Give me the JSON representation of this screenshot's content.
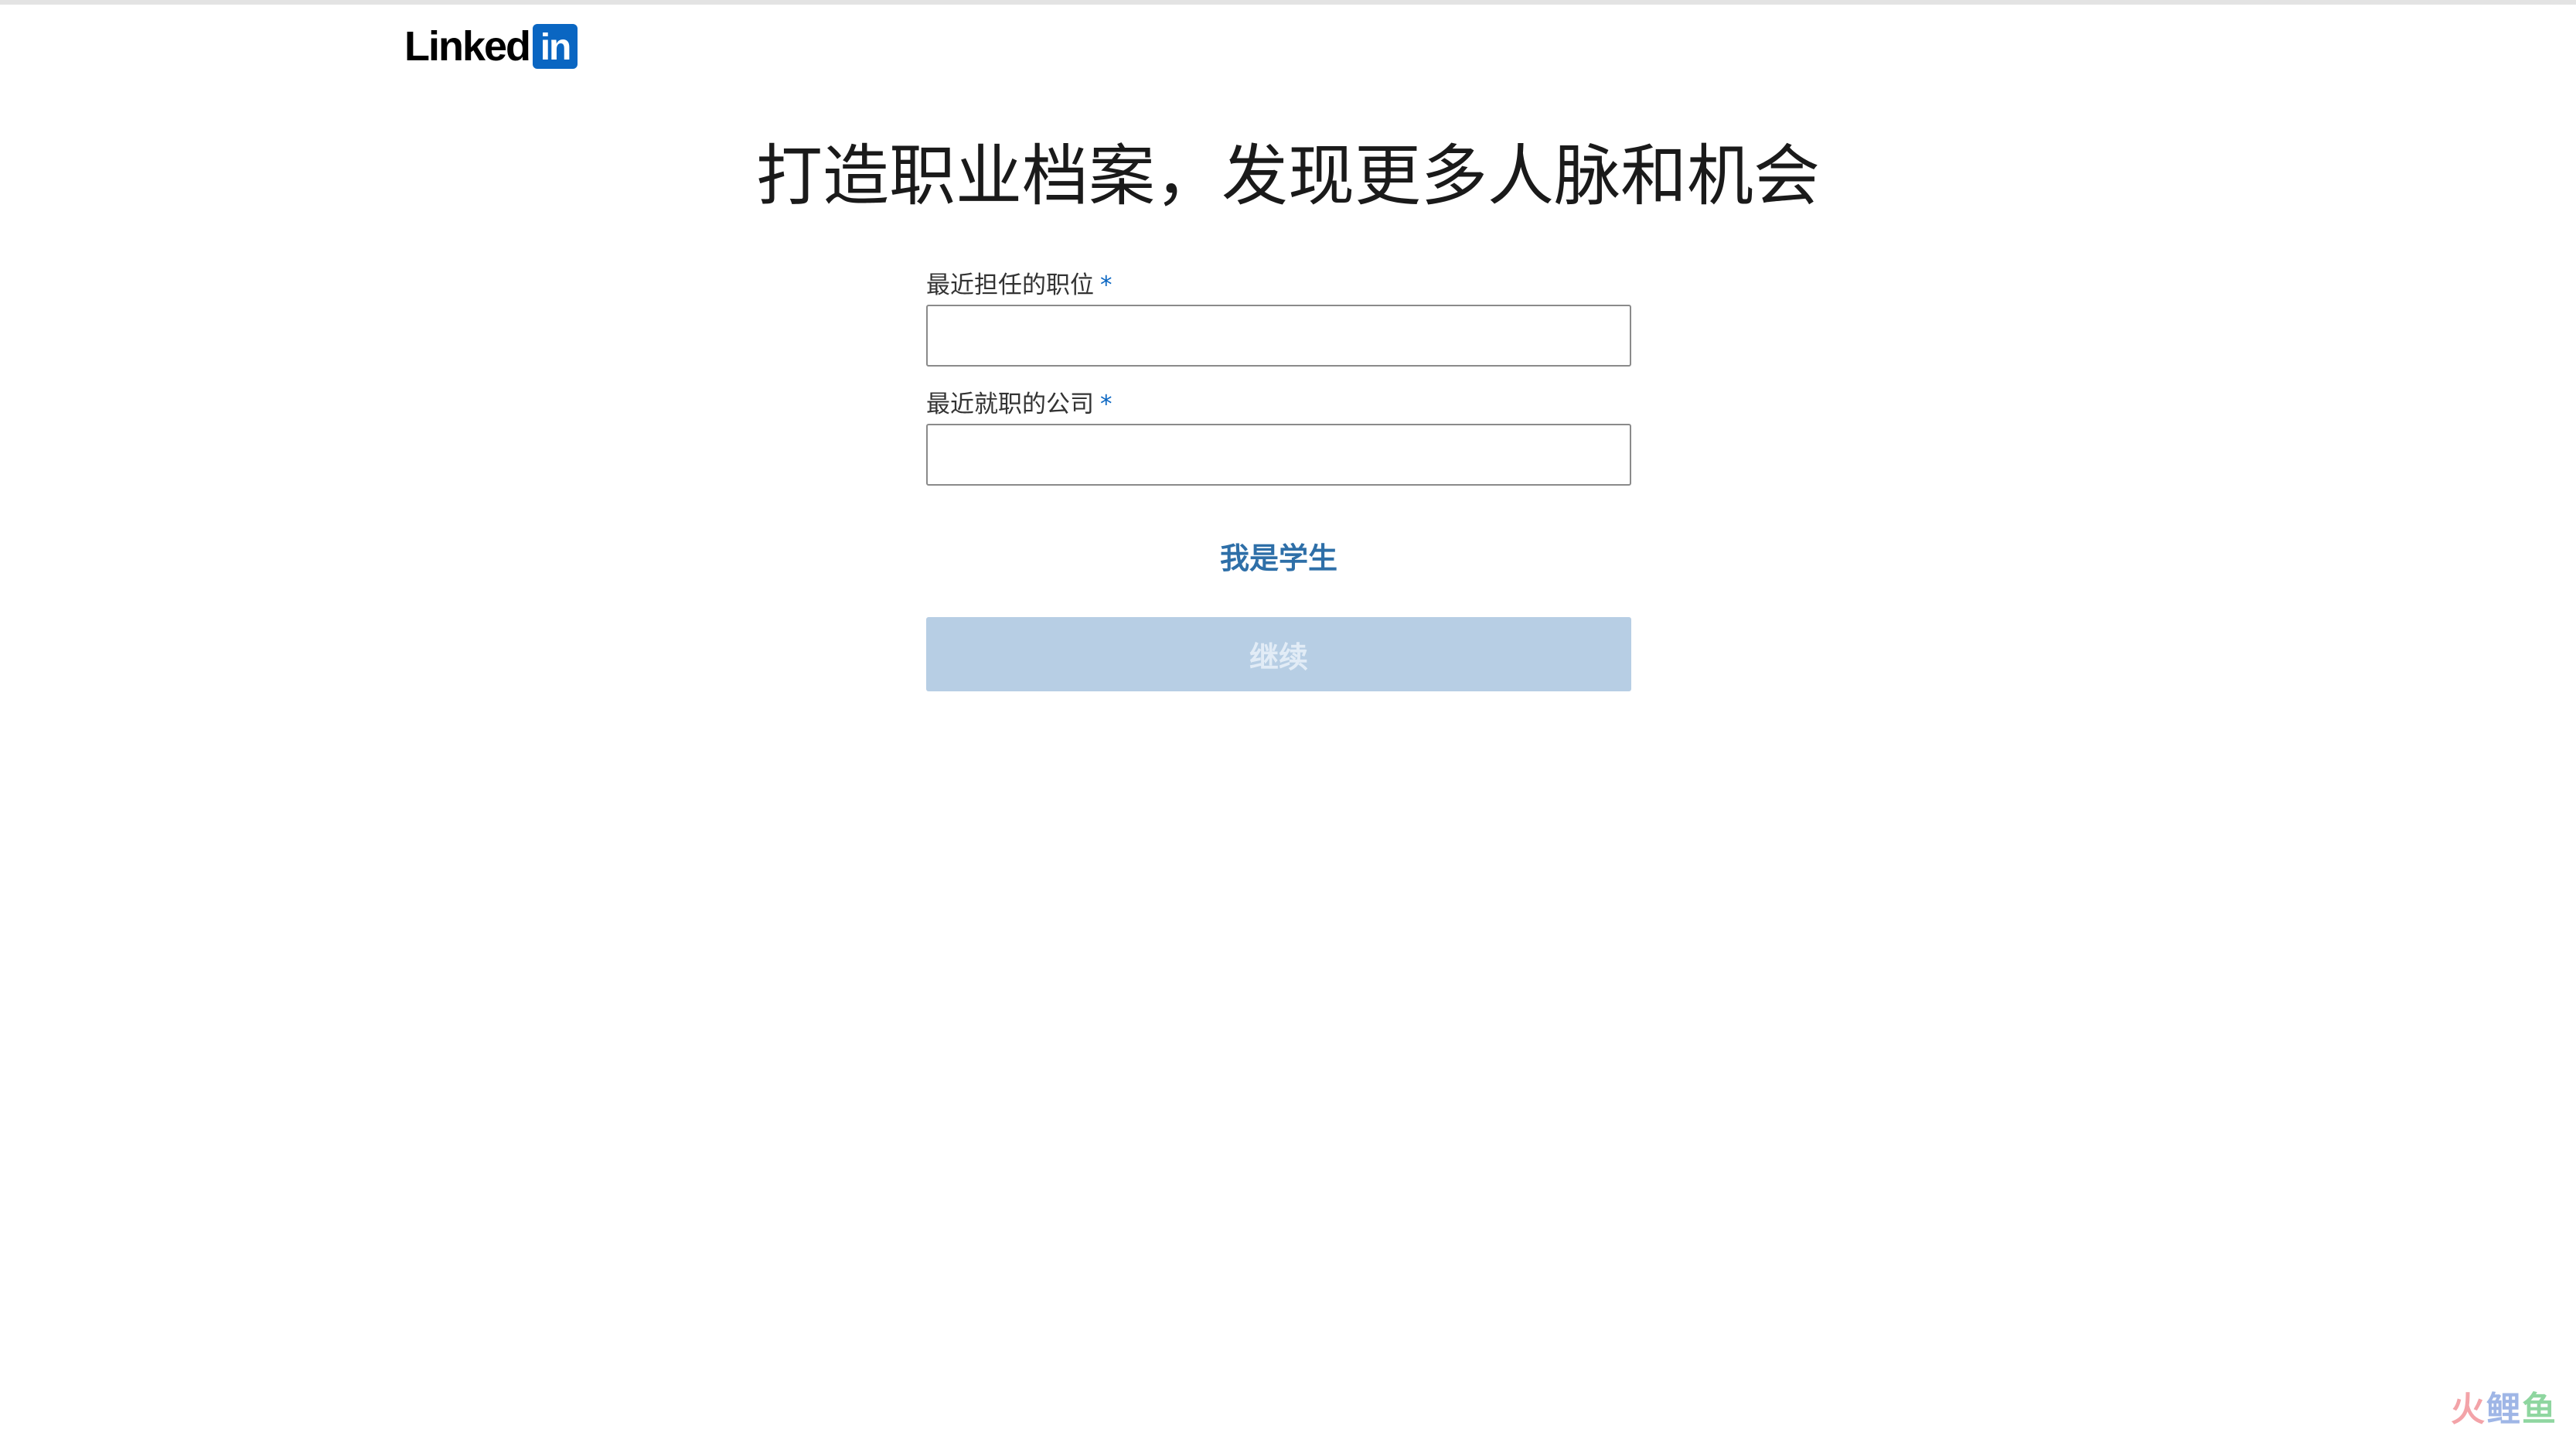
{
  "brand": {
    "logo_word": "Linked",
    "logo_box": "in",
    "box_color": "#0a66c2"
  },
  "page": {
    "title": "打造职业档案，发现更多人脉和机会"
  },
  "form": {
    "position_label": "最近担任的职位",
    "position_value": "",
    "company_label": "最近就职的公司",
    "company_value": "",
    "required_marker": "*",
    "student_link": "我是学生",
    "continue_label": "继续"
  },
  "watermark": {
    "chars": [
      "火",
      "鲤",
      "鱼"
    ]
  },
  "colors": {
    "accent": "#0a66c2",
    "link": "#2e6fa8",
    "button_disabled_bg": "#b7cee4",
    "button_disabled_text": "#e2ecf6"
  }
}
